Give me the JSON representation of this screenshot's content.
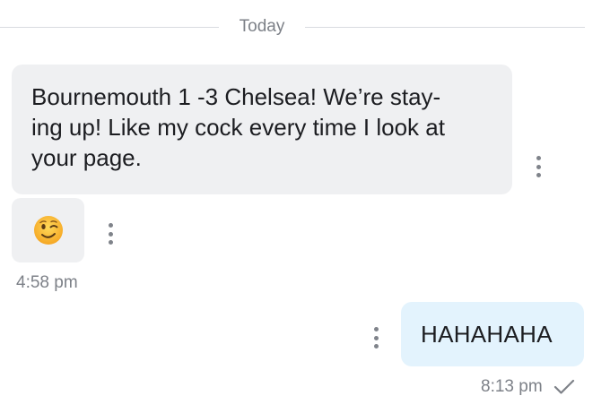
{
  "conversation": {
    "date_divider": "Today",
    "incoming": {
      "message_text": "Bournemouth 1 -3 Chelsea! We’re stay-\ning up! Like my cock every time I look at\nyour page.",
      "emoji_icon": "winking-face-icon",
      "timestamp": "4:58 pm"
    },
    "outgoing": {
      "message_text": "HAHAHAHA",
      "timestamp": "8:13 pm",
      "status_icon": "checkmark-icon"
    }
  },
  "colors": {
    "incoming_bubble": "#eff0f2",
    "outgoing_bubble": "#e3f3fd",
    "meta_text": "#7d8188",
    "divider": "#d9dbe0"
  }
}
